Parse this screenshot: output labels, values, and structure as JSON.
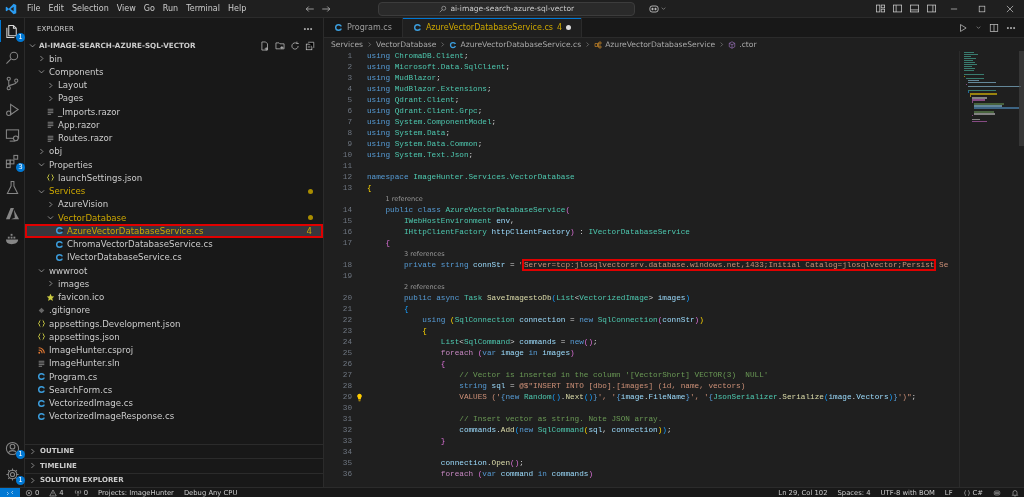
{
  "title_bar": {
    "menu": [
      "File",
      "Edit",
      "Selection",
      "View",
      "Go",
      "Run",
      "Terminal",
      "Help"
    ],
    "command_center": "ai-image-search-azure-sql-vector"
  },
  "activity_bar": {
    "top": [
      {
        "kind": "files",
        "badge": "1",
        "selected": true
      },
      {
        "kind": "search",
        "selected": false
      },
      {
        "kind": "branch",
        "selected": false
      },
      {
        "kind": "debug",
        "selected": false
      },
      {
        "kind": "remote",
        "selected": false
      },
      {
        "kind": "extensions",
        "badge": "3",
        "selected": false
      },
      {
        "kind": "flask",
        "selected": false
      },
      {
        "kind": "azure",
        "selected": false
      },
      {
        "kind": "docker",
        "selected": false
      }
    ],
    "bottom": [
      {
        "kind": "account",
        "badge": "1",
        "selected": false
      },
      {
        "kind": "gear",
        "badge": "1",
        "selected": false
      }
    ]
  },
  "explorer": {
    "title": "EXPLORER",
    "root": {
      "name": "AI-IMAGE-SEARCH-AZURE-SQL-VECTOR",
      "expanded": true
    },
    "tree": [
      {
        "name": "bin",
        "expanded": false,
        "modified": false
      },
      {
        "name": "Components",
        "expanded": true,
        "modified": false,
        "children": [
          {
            "name": "Layout",
            "expanded": false,
            "modified": false
          },
          {
            "name": "Pages",
            "expanded": false,
            "modified": false
          },
          {
            "name": "_Imports.razor",
            "kind": "lines",
            "selected": false
          },
          {
            "name": "App.razor",
            "kind": "lines",
            "selected": false
          },
          {
            "name": "Routes.razor",
            "kind": "lines",
            "selected": false
          }
        ]
      },
      {
        "name": "obj",
        "expanded": false,
        "modified": false
      },
      {
        "name": "Properties",
        "expanded": true,
        "modified": false,
        "children": [
          {
            "name": "launchSettings.json",
            "kind": "json",
            "selected": false
          }
        ]
      },
      {
        "name": "Services",
        "expanded": true,
        "modified": true,
        "children": [
          {
            "name": "AzureVision",
            "expanded": false,
            "modified": false
          },
          {
            "name": "VectorDatabase",
            "expanded": true,
            "modified": true,
            "children": [
              {
                "name": "AzureVectorDatabaseService.cs",
                "kind": "cs",
                "selected": true,
                "badge": "4",
                "annotated": true
              },
              {
                "name": "ChromaVectorDatabaseService.cs",
                "kind": "cs",
                "selected": false
              },
              {
                "name": "IVectorDatabaseService.cs",
                "kind": "cs",
                "selected": false
              }
            ]
          }
        ]
      },
      {
        "name": "wwwroot",
        "expanded": true,
        "modified": false,
        "children": [
          {
            "name": "images",
            "expanded": false,
            "modified": false
          },
          {
            "name": "favicon.ico",
            "kind": "star",
            "selected": false
          }
        ]
      },
      {
        "name": ".gitignore",
        "kind": "git",
        "selected": false
      },
      {
        "name": "appsettings.Development.json",
        "kind": "json",
        "selected": false
      },
      {
        "name": "appsettings.json",
        "kind": "json",
        "selected": false
      },
      {
        "name": "ImageHunter.csproj",
        "kind": "rss",
        "selected": false
      },
      {
        "name": "ImageHunter.sln",
        "kind": "lines",
        "selected": false
      },
      {
        "name": "Program.cs",
        "kind": "cs",
        "selected": false
      },
      {
        "name": "SearchForm.cs",
        "kind": "cs",
        "selected": false
      },
      {
        "name": "VectorizedImage.cs",
        "kind": "cs",
        "selected": false
      },
      {
        "name": "VectorizedImageResponse.cs",
        "kind": "cs",
        "selected": false
      }
    ],
    "sections": [
      {
        "label": "OUTLINE",
        "expanded": false
      },
      {
        "label": "TIMELINE",
        "expanded": false
      },
      {
        "label": "SOLUTION EXPLORER",
        "expanded": false
      }
    ]
  },
  "editor": {
    "tabs": [
      {
        "label": "Program.cs",
        "kind": "cs",
        "selected": false
      },
      {
        "label": "AzureVectorDatabaseService.cs",
        "kind": "cs",
        "selected": true,
        "badge": "4",
        "unsaved": true
      }
    ],
    "breadcrumbs": [
      {
        "text": "Services",
        "kind": "folder"
      },
      {
        "text": "VectorDatabase",
        "kind": "folder"
      },
      {
        "text": "AzureVectorDatabaseService.cs",
        "kind": "cs"
      },
      {
        "text": "AzureVectorDatabaseService",
        "kind": "class"
      },
      {
        "text": ".ctor",
        "kind": "method"
      }
    ],
    "lines": [
      {
        "kind": "code",
        "number": "1",
        "tokens": [
          {
            "text": "using ",
            "kind": "kw"
          },
          {
            "text": "ChromaDB.Client",
            "kind": "type"
          },
          {
            "text": ";",
            "kind": "plain"
          }
        ]
      },
      {
        "kind": "code",
        "number": "2",
        "tokens": [
          {
            "text": "using ",
            "kind": "kw"
          },
          {
            "text": "Microsoft.Data.SqlClient",
            "kind": "type"
          },
          {
            "text": ";",
            "kind": "plain"
          }
        ]
      },
      {
        "kind": "code",
        "number": "3",
        "tokens": [
          {
            "text": "using ",
            "kind": "kw"
          },
          {
            "text": "MudBlazor",
            "kind": "type"
          },
          {
            "text": ";",
            "kind": "plain"
          }
        ]
      },
      {
        "kind": "code",
        "number": "4",
        "tokens": [
          {
            "text": "using ",
            "kind": "kw"
          },
          {
            "text": "MudBlazor.Extensions",
            "kind": "type"
          },
          {
            "text": ";",
            "kind": "plain"
          }
        ]
      },
      {
        "kind": "code",
        "number": "5",
        "tokens": [
          {
            "text": "using ",
            "kind": "kw"
          },
          {
            "text": "Qdrant.Client",
            "kind": "type"
          },
          {
            "text": ";",
            "kind": "plain"
          }
        ]
      },
      {
        "kind": "code",
        "number": "6",
        "tokens": [
          {
            "text": "using ",
            "kind": "kw"
          },
          {
            "text": "Qdrant.Client.Grpc",
            "kind": "type"
          },
          {
            "text": ";",
            "kind": "plain"
          }
        ]
      },
      {
        "kind": "code",
        "number": "7",
        "tokens": [
          {
            "text": "using ",
            "kind": "kw"
          },
          {
            "text": "System.ComponentModel",
            "kind": "type"
          },
          {
            "text": ";",
            "kind": "plain"
          }
        ]
      },
      {
        "kind": "code",
        "number": "8",
        "tokens": [
          {
            "text": "using ",
            "kind": "kw"
          },
          {
            "text": "System.Data",
            "kind": "type"
          },
          {
            "text": ";",
            "kind": "plain"
          }
        ]
      },
      {
        "kind": "code",
        "number": "9",
        "tokens": [
          {
            "text": "using ",
            "kind": "kw"
          },
          {
            "text": "System.Data.Common",
            "kind": "type"
          },
          {
            "text": ";",
            "kind": "plain"
          }
        ]
      },
      {
        "kind": "code",
        "number": "10",
        "tokens": [
          {
            "text": "using ",
            "kind": "kw"
          },
          {
            "text": "System.Text.Json",
            "kind": "type"
          },
          {
            "text": ";",
            "kind": "plain"
          }
        ]
      },
      {
        "kind": "code",
        "number": "11"
      },
      {
        "kind": "code",
        "number": "12",
        "tokens": [
          {
            "text": "namespace ",
            "kind": "kw"
          },
          {
            "text": "ImageHunter.Services.VectorDatabase",
            "kind": "type"
          }
        ]
      },
      {
        "kind": "code",
        "number": "13",
        "tokens": [
          {
            "text": "{",
            "kind": "brace1"
          }
        ]
      },
      {
        "kind": "lens",
        "text": "1 reference"
      },
      {
        "kind": "code",
        "number": "14",
        "tokens": [
          {
            "text": "    public class ",
            "kind": "kw"
          },
          {
            "text": "AzureVectorDatabaseService",
            "kind": "type"
          },
          {
            "text": "(",
            "kind": "brace2"
          }
        ]
      },
      {
        "kind": "code",
        "number": "15",
        "tokens": [
          {
            "text": "        IWebHostEnvironment",
            "kind": "type"
          },
          {
            "text": " env",
            "kind": "var"
          },
          {
            "text": ",",
            "kind": "plain"
          }
        ]
      },
      {
        "kind": "code",
        "number": "16",
        "tokens": [
          {
            "text": "        IHttpClientFactory",
            "kind": "type"
          },
          {
            "text": " httpClientFactory",
            "kind": "var"
          },
          {
            "text": ")",
            "kind": "brace2"
          },
          {
            "text": " : ",
            "kind": "plain"
          },
          {
            "text": "IVectorDatabaseService",
            "kind": "type"
          }
        ]
      },
      {
        "kind": "code",
        "number": "17",
        "tokens": [
          {
            "text": "    {",
            "kind": "brace2"
          }
        ]
      },
      {
        "kind": "lens",
        "text": "3 references"
      },
      {
        "kind": "code",
        "number": "18",
        "tokens": [
          {
            "text": "        private string ",
            "kind": "kw"
          },
          {
            "text": "connStr",
            "kind": "var"
          },
          {
            "text": " = ",
            "kind": "plain"
          },
          {
            "text": "\"",
            "kind": "str"
          },
          {
            "text": "Server=tcp:jlosqlvectorsrv.database.windows.net,1433;Initial Catalog=jlosqlvector;Persist",
            "kind": "str",
            "annotated": true
          },
          {
            "text": " Se",
            "kind": "str"
          }
        ]
      },
      {
        "kind": "code",
        "number": "19"
      },
      {
        "kind": "lens",
        "text": "2 references"
      },
      {
        "kind": "code",
        "number": "20",
        "tokens": [
          {
            "text": "        public async ",
            "kind": "kw"
          },
          {
            "text": "Task",
            "kind": "type"
          },
          {
            "text": " SaveImagestoDb",
            "kind": "fn"
          },
          {
            "text": "(",
            "kind": "brace3"
          },
          {
            "text": "List",
            "kind": "type"
          },
          {
            "text": "<",
            "kind": "plain"
          },
          {
            "text": "VectorizedImage",
            "kind": "type"
          },
          {
            "text": "> ",
            "kind": "plain"
          },
          {
            "text": "images",
            "kind": "var"
          },
          {
            "text": ")",
            "kind": "brace3"
          }
        ]
      },
      {
        "kind": "code",
        "number": "21",
        "tokens": [
          {
            "text": "        {",
            "kind": "brace3"
          }
        ]
      },
      {
        "kind": "code",
        "number": "22",
        "tokens": [
          {
            "text": "            using ",
            "kind": "kw"
          },
          {
            "text": "(",
            "kind": "brace1"
          },
          {
            "text": "SqlConnection",
            "kind": "type"
          },
          {
            "text": " connection",
            "kind": "var"
          },
          {
            "text": " = ",
            "kind": "plain"
          },
          {
            "text": "new ",
            "kind": "kw"
          },
          {
            "text": "SqlConnection",
            "kind": "type"
          },
          {
            "text": "(",
            "kind": "brace2"
          },
          {
            "text": "connStr",
            "kind": "var"
          },
          {
            "text": ")",
            "kind": "brace2"
          },
          {
            "text": ")",
            "kind": "brace1"
          }
        ]
      },
      {
        "kind": "code",
        "number": "23",
        "tokens": [
          {
            "text": "            {",
            "kind": "brace1"
          }
        ]
      },
      {
        "kind": "code",
        "number": "24",
        "tokens": [
          {
            "text": "                List",
            "kind": "type"
          },
          {
            "text": "<",
            "kind": "plain"
          },
          {
            "text": "SqlCommand",
            "kind": "type"
          },
          {
            "text": "> ",
            "kind": "plain"
          },
          {
            "text": "commands",
            "kind": "var"
          },
          {
            "text": " = ",
            "kind": "plain"
          },
          {
            "text": "new",
            "kind": "kw"
          },
          {
            "text": "()",
            "kind": "brace2"
          },
          {
            "text": ";",
            "kind": "plain"
          }
        ]
      },
      {
        "kind": "code",
        "number": "25",
        "tokens": [
          {
            "text": "                foreach ",
            "kind": "ctl"
          },
          {
            "text": "(",
            "kind": "brace2"
          },
          {
            "text": "var ",
            "kind": "kw"
          },
          {
            "text": "image",
            "kind": "var"
          },
          {
            "text": " in ",
            "kind": "kw"
          },
          {
            "text": "images",
            "kind": "var"
          },
          {
            "text": ")",
            "kind": "brace2"
          }
        ]
      },
      {
        "kind": "code",
        "number": "26",
        "tokens": [
          {
            "text": "                {",
            "kind": "brace2"
          }
        ]
      },
      {
        "kind": "code",
        "number": "27",
        "tokens": [
          {
            "text": "                    // Vector is inserted in the column '[VectorShort] VECTOR(3)  NULL'",
            "kind": "com"
          }
        ]
      },
      {
        "kind": "code",
        "number": "28",
        "tokens": [
          {
            "text": "                    string ",
            "kind": "kw"
          },
          {
            "text": "sql",
            "kind": "var"
          },
          {
            "text": " = ",
            "kind": "plain"
          },
          {
            "text": "@$\"INSERT INTO [dbo].[images] (id, name, vectors)",
            "kind": "str"
          }
        ]
      },
      {
        "kind": "code",
        "number": "29",
        "lightbulb": true,
        "tokens": [
          {
            "text": "                    VALUES ('",
            "kind": "str"
          },
          {
            "text": "{",
            "kind": "kw"
          },
          {
            "text": "new ",
            "kind": "kw"
          },
          {
            "text": "Random",
            "kind": "type"
          },
          {
            "text": "()",
            "kind": "brace3"
          },
          {
            "text": ".",
            "kind": "plain"
          },
          {
            "text": "Next",
            "kind": "fn"
          },
          {
            "text": "()",
            "kind": "brace3"
          },
          {
            "text": "}",
            "kind": "kw"
          },
          {
            "text": "', '",
            "kind": "str"
          },
          {
            "text": "{",
            "kind": "kw"
          },
          {
            "text": "image",
            "kind": "var"
          },
          {
            "text": ".",
            "kind": "plain"
          },
          {
            "text": "FileName",
            "kind": "var"
          },
          {
            "text": "}",
            "kind": "kw"
          },
          {
            "text": "', '",
            "kind": "str"
          },
          {
            "text": "{",
            "kind": "kw"
          },
          {
            "text": "JsonSerializer",
            "kind": "type"
          },
          {
            "text": ".",
            "kind": "plain"
          },
          {
            "text": "Serialize",
            "kind": "fn"
          },
          {
            "text": "(",
            "kind": "brace3"
          },
          {
            "text": "image",
            "kind": "var"
          },
          {
            "text": ".",
            "kind": "plain"
          },
          {
            "text": "Vectors",
            "kind": "var"
          },
          {
            "text": ")",
            "kind": "brace3"
          },
          {
            "text": "}",
            "kind": "kw"
          },
          {
            "text": "')\"",
            "kind": "str"
          },
          {
            "text": ";",
            "kind": "plain"
          }
        ]
      },
      {
        "kind": "code",
        "number": "30"
      },
      {
        "kind": "code",
        "number": "31",
        "tokens": [
          {
            "text": "                    // Insert vector as string. Note JSON array.",
            "kind": "com"
          }
        ]
      },
      {
        "kind": "code",
        "number": "32",
        "tokens": [
          {
            "text": "                    commands",
            "kind": "var"
          },
          {
            "text": ".",
            "kind": "plain"
          },
          {
            "text": "Add",
            "kind": "fn"
          },
          {
            "text": "(",
            "kind": "brace3"
          },
          {
            "text": "new ",
            "kind": "kw"
          },
          {
            "text": "SqlCommand",
            "kind": "type"
          },
          {
            "text": "(",
            "kind": "brace1"
          },
          {
            "text": "sql",
            "kind": "var"
          },
          {
            "text": ", ",
            "kind": "plain"
          },
          {
            "text": "connection",
            "kind": "var"
          },
          {
            "text": ")",
            "kind": "brace1"
          },
          {
            "text": ")",
            "kind": "brace3"
          },
          {
            "text": ";",
            "kind": "plain"
          }
        ]
      },
      {
        "kind": "code",
        "number": "33",
        "tokens": [
          {
            "text": "                }",
            "kind": "brace2"
          }
        ]
      },
      {
        "kind": "code",
        "number": "34"
      },
      {
        "kind": "code",
        "number": "35",
        "tokens": [
          {
            "text": "                connection",
            "kind": "var"
          },
          {
            "text": ".",
            "kind": "plain"
          },
          {
            "text": "Open",
            "kind": "fn"
          },
          {
            "text": "()",
            "kind": "brace2"
          },
          {
            "text": ";",
            "kind": "plain"
          }
        ]
      },
      {
        "kind": "code",
        "number": "36",
        "tokens": [
          {
            "text": "                foreach ",
            "kind": "ctl"
          },
          {
            "text": "(",
            "kind": "brace2"
          },
          {
            "text": "var ",
            "kind": "kw"
          },
          {
            "text": "command",
            "kind": "var"
          },
          {
            "text": " in ",
            "kind": "kw"
          },
          {
            "text": "commands",
            "kind": "var"
          },
          {
            "text": ")",
            "kind": "brace2"
          }
        ]
      }
    ]
  },
  "status_bar": {
    "left": [
      {
        "kind": "remote"
      },
      {
        "kind": "error",
        "text": "0"
      },
      {
        "kind": "warning",
        "text": "4"
      },
      {
        "kind": "ports",
        "text": "0"
      },
      {
        "kind": "text",
        "text": "Projects: ImageHunter"
      },
      {
        "kind": "text",
        "text": "Debug Any CPU"
      }
    ],
    "right": [
      {
        "kind": "text",
        "text": "Ln 29, Col 102"
      },
      {
        "kind": "text",
        "text": "Spaces: 4"
      },
      {
        "kind": "text",
        "text": "UTF-8 with BOM"
      },
      {
        "kind": "text",
        "text": "LF"
      },
      {
        "kind": "braces",
        "text": "C#"
      },
      {
        "kind": "copilot"
      },
      {
        "kind": "bell"
      }
    ]
  }
}
